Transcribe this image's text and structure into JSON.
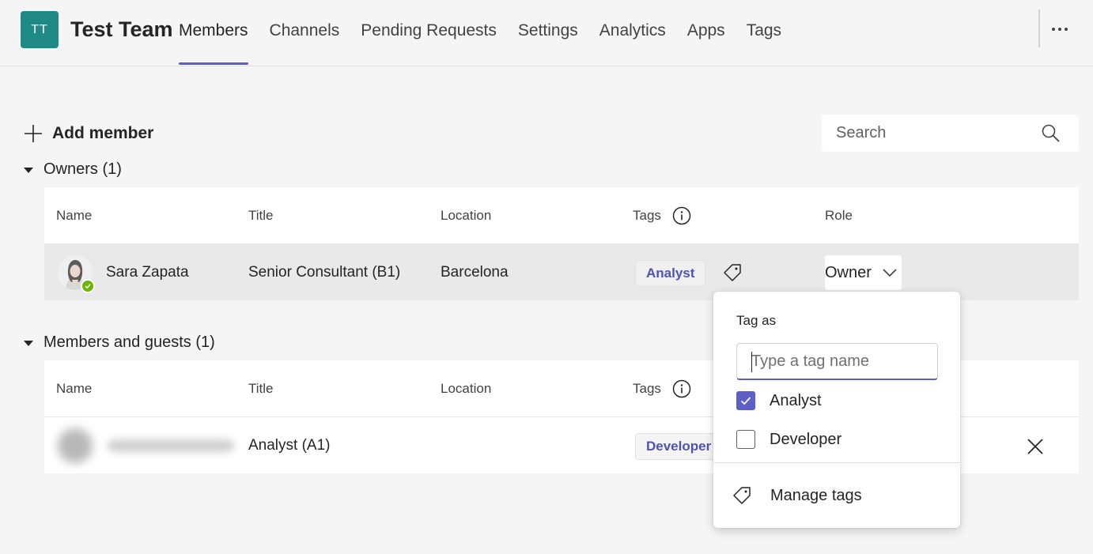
{
  "team": {
    "initials": "TT",
    "name": "Test Team"
  },
  "tabs": [
    {
      "label": "Members",
      "active": true
    },
    {
      "label": "Channels"
    },
    {
      "label": "Pending Requests"
    },
    {
      "label": "Settings"
    },
    {
      "label": "Analytics"
    },
    {
      "label": "Apps"
    },
    {
      "label": "Tags"
    }
  ],
  "toolbar": {
    "add_member_label": "Add member",
    "search_placeholder": "Search"
  },
  "columns": {
    "name": "Name",
    "title": "Title",
    "location": "Location",
    "tags": "Tags",
    "role": "Role"
  },
  "owners": {
    "heading": "Owners (1)",
    "rows": [
      {
        "name": "Sara Zapata",
        "title": "Senior Consultant (B1)",
        "location": "Barcelona",
        "tag": "Analyst",
        "role": "Owner"
      }
    ]
  },
  "members": {
    "heading": "Members and guests (1)",
    "rows": [
      {
        "name": "",
        "title": "Analyst (A1)",
        "location": "",
        "tag": "Developer"
      }
    ]
  },
  "tag_popup": {
    "title": "Tag as",
    "input_placeholder": "Type a tag name",
    "options": [
      {
        "label": "Analyst",
        "checked": true
      },
      {
        "label": "Developer",
        "checked": false
      }
    ],
    "manage_label": "Manage tags"
  },
  "colors": {
    "accent": "#5b5fc7",
    "team_avatar": "#1f8a85",
    "presence_available": "#6bb700",
    "tag_text": "#4f52b2"
  },
  "icons": {
    "more": "more-options-icon",
    "add": "plus-icon",
    "search": "search-icon",
    "info": "info-icon",
    "tag": "tag-icon",
    "role_dropdown": "chevron-down-icon",
    "remove": "close-icon",
    "check": "checkmark-icon"
  }
}
